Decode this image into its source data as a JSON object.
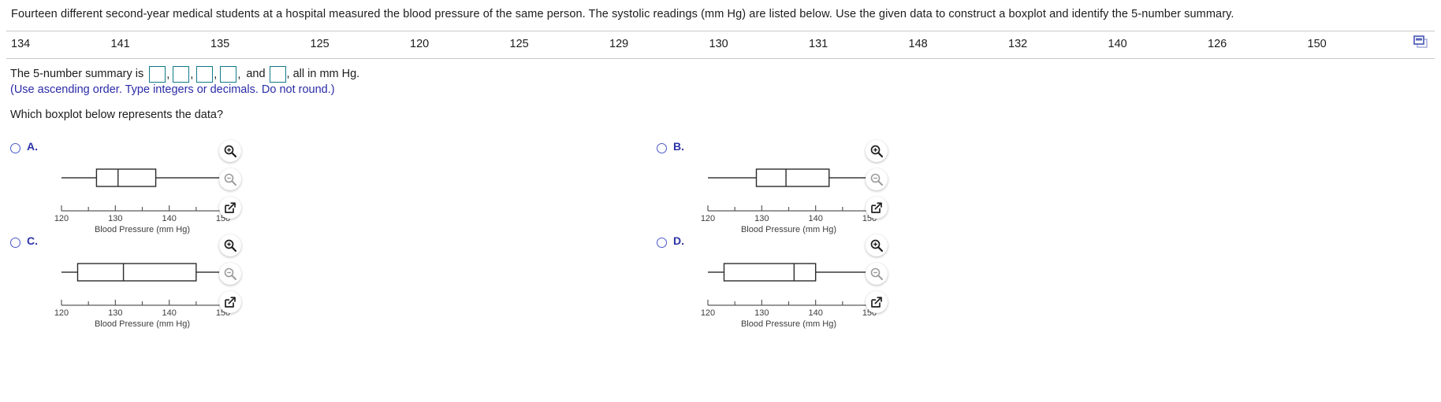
{
  "question": {
    "stem": "Fourteen different second-year medical students at a hospital measured the blood pressure of the same person. The systolic readings (mm Hg) are listed below. Use the given data to construct a boxplot and identify the 5-number summary.",
    "data_values": [
      "134",
      "141",
      "135",
      "125",
      "120",
      "125",
      "129",
      "130",
      "131",
      "148",
      "132",
      "140",
      "126",
      "150"
    ],
    "answer_prefix": "The 5-number summary is",
    "answer_suffix_and": "and",
    "answer_suffix_units": ", all in mm Hg.",
    "hint": "(Use ascending order. Type integers or decimals. Do not round.)",
    "prompt": "Which boxplot below represents the data?",
    "blank_values": [
      "",
      "",
      "",
      "",
      ""
    ],
    "blank_count": 5,
    "copy_icon": "copy-data-icon",
    "accent_blue": "#2c33a8",
    "hint_color": "#2b2ba8",
    "blank_border": "#127a88"
  },
  "choices": [
    {
      "letter": "A.",
      "name": "choice-a",
      "axis_label": "Blood Pressure (mm Hg)",
      "ticks": [
        120,
        125,
        130,
        135,
        140,
        145,
        150
      ],
      "tick_labels": [
        "120",
        "130",
        "140",
        "150"
      ],
      "labeled_ticks": [
        120,
        130,
        140,
        150
      ],
      "boxplot": {
        "min": 120,
        "q1": 126.5,
        "median": 130.5,
        "q3": 137.5,
        "max": 150
      },
      "icons": [
        "zoom-in-icon",
        "zoom-out-icon",
        "expand-icon"
      ]
    },
    {
      "letter": "B.",
      "name": "choice-b",
      "axis_label": "Blood Pressure (mm Hg)",
      "ticks": [
        120,
        125,
        130,
        135,
        140,
        145,
        150
      ],
      "tick_labels": [
        "120",
        "130",
        "140",
        "150"
      ],
      "labeled_ticks": [
        120,
        130,
        140,
        150
      ],
      "boxplot": {
        "min": 120,
        "q1": 129,
        "median": 134.5,
        "q3": 142.5,
        "max": 150
      },
      "icons": [
        "zoom-in-icon",
        "zoom-out-icon",
        "expand-icon"
      ]
    },
    {
      "letter": "C.",
      "name": "choice-c",
      "axis_label": "Blood Pressure (mm Hg)",
      "ticks": [
        120,
        125,
        130,
        135,
        140,
        145,
        150
      ],
      "tick_labels": [
        "120",
        "130",
        "140",
        "150"
      ],
      "labeled_ticks": [
        120,
        130,
        140,
        150
      ],
      "boxplot": {
        "min": 120,
        "q1": 123,
        "median": 131.5,
        "q3": 145,
        "max": 150
      },
      "icons": [
        "zoom-in-icon",
        "zoom-out-icon",
        "expand-icon"
      ]
    },
    {
      "letter": "D.",
      "name": "choice-d",
      "axis_label": "Blood Pressure (mm Hg)",
      "ticks": [
        120,
        125,
        130,
        135,
        140,
        145,
        150
      ],
      "tick_labels": [
        "120",
        "130",
        "140",
        "150"
      ],
      "labeled_ticks": [
        120,
        130,
        140,
        150
      ],
      "boxplot": {
        "min": 120,
        "q1": 123,
        "median": 136,
        "q3": 140,
        "max": 150
      },
      "icons": [
        "zoom-in-icon",
        "zoom-out-icon",
        "expand-icon"
      ]
    }
  ],
  "chart_data": {
    "type": "box",
    "title": "",
    "xlabel": "Blood Pressure (mm Hg)",
    "ylabel": "",
    "xlim": [
      120,
      150
    ],
    "ticks": [
      120,
      125,
      130,
      135,
      140,
      145,
      150
    ],
    "tick_labels": [
      "120",
      "",
      "130",
      "",
      "140",
      "",
      "150"
    ],
    "grid": false,
    "legend": "none",
    "dataset": [
      134,
      141,
      135,
      125,
      120,
      125,
      129,
      130,
      131,
      148,
      132,
      140,
      126,
      150
    ],
    "boxes": [
      {
        "name": "A",
        "min": 120,
        "q1": 126.5,
        "median": 130.5,
        "q3": 137.5,
        "max": 150
      },
      {
        "name": "B",
        "min": 120,
        "q1": 129,
        "median": 134.5,
        "q3": 142.5,
        "max": 150
      },
      {
        "name": "C",
        "min": 120,
        "q1": 123,
        "median": 131.5,
        "q3": 145,
        "max": 150
      },
      {
        "name": "D",
        "min": 120,
        "q1": 123,
        "median": 136,
        "q3": 140,
        "max": 150
      }
    ]
  }
}
